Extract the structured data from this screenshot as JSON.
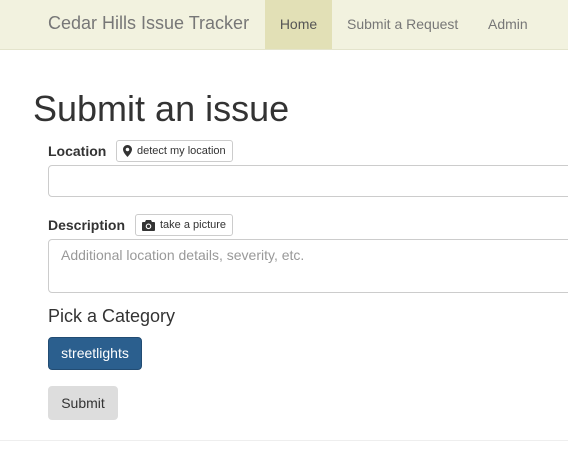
{
  "navbar": {
    "brand": "Cedar Hills Issue Tracker",
    "items": [
      {
        "label": "Home",
        "active": true
      },
      {
        "label": "Submit a Request",
        "active": false
      },
      {
        "label": "Admin",
        "active": false
      }
    ]
  },
  "form": {
    "title": "Submit an issue",
    "location": {
      "label": "Location",
      "detect_button": "detect my location",
      "detect_icon": "map-marker-icon",
      "value": "",
      "placeholder": ""
    },
    "description": {
      "label": "Description",
      "picture_button": "take a picture",
      "picture_icon": "camera-icon",
      "value": "",
      "placeholder": "Additional location details, severity, etc."
    },
    "category": {
      "heading": "Pick a Category",
      "options": [
        {
          "label": "streetlights",
          "selected": true
        }
      ]
    },
    "submit_label": "Submit"
  },
  "colors": {
    "navbar_bg": "#f2f2df",
    "nav_active_bg": "#e2e0b6",
    "category_btn": "#2b5f8e",
    "submit_btn": "#dddddd"
  }
}
